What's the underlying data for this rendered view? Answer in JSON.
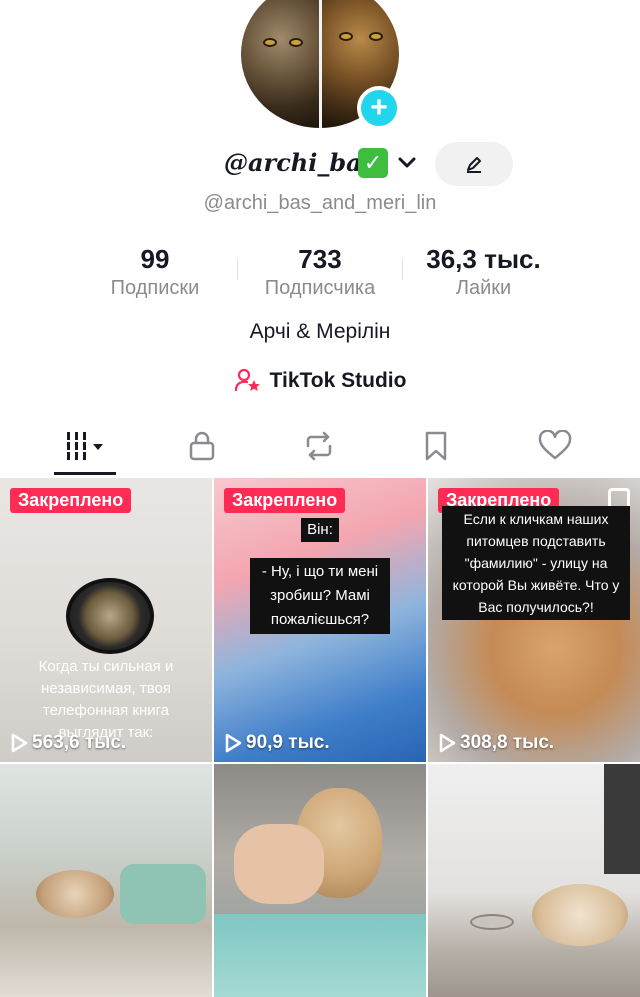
{
  "profile": {
    "display_name": "@archi_bas",
    "verified_glyph": "✓",
    "username": "@archi_bas_and_meri_lin",
    "bio": "Арчі & Мерілін",
    "plus_glyph": "+"
  },
  "stats": [
    {
      "value": "99",
      "label": "Подписки"
    },
    {
      "value": "733",
      "label": "Подписчика"
    },
    {
      "value": "36,3 тыс.",
      "label": "Лайки"
    }
  ],
  "studio": {
    "label": "TikTok Studio"
  },
  "tabs": [
    "videos-grid-icon",
    "lock-icon",
    "repost-icon",
    "bookmark-icon",
    "heart-icon"
  ],
  "videos": [
    {
      "pinned": "Закреплено",
      "views": "563,6 тыс.",
      "caption": "Когда ты сильная и независимая, твоя телефонная книга выглядит так:"
    },
    {
      "pinned": "Закреплено",
      "views": "90,9 тыс.",
      "caption_line1": "Він:",
      "caption_line2": "- Ну, і що ти мені зробиш? Мамі пожалієшься?"
    },
    {
      "pinned": "Закреплено",
      "views": "308,8 тыс.",
      "caption": "Если к кличкам наших питомцев подставить \"фамилию\" - улицу на которой Вы живёте. Что у Вас получилось?!"
    },
    {
      "views": ""
    },
    {
      "views": ""
    },
    {
      "views": ""
    }
  ],
  "colors": {
    "accent": "#fe2c55",
    "teal": "#20d5ec",
    "muted": "#8a8b91",
    "verified": "#3fbd3f"
  }
}
